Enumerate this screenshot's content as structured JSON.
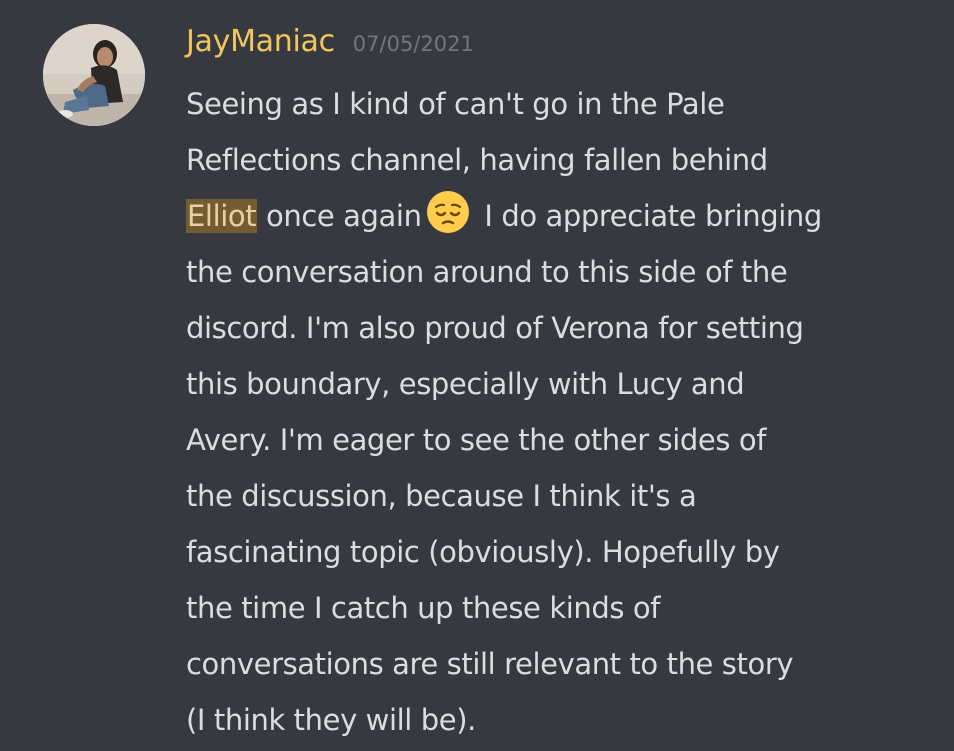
{
  "message": {
    "author": "JayManiac",
    "timestamp": "07/05/2021",
    "author_color": "#f1c75d",
    "avatar": "avatar-photo",
    "lines": {
      "l1": "Seeing as I kind of can't go in the Pale",
      "l2": "Reflections channel, having fallen behind",
      "l3_mention": "Elliot",
      "l3_before_emoji": " once again",
      "l3_emoji": "pensive-face-emoji",
      "l3_after_emoji": " I do appreciate bringing",
      "l4": "the conversation around to this side of the",
      "l5": "discord. I'm also proud of Verona for setting",
      "l6": "this boundary, especially with Lucy and",
      "l7": "Avery. I'm eager to see the other sides of",
      "l8": "the discussion, because I think it's a",
      "l9": "fascinating topic (obviously). Hopefully by",
      "l10": "the time I catch up these kinds of",
      "l11": "conversations are still relevant to the story",
      "l12": "(I think they will be)."
    },
    "colors": {
      "background": "#36393f",
      "text": "#dcddde",
      "timestamp": "#72767d",
      "mention_bg": "#5c4e36"
    }
  }
}
